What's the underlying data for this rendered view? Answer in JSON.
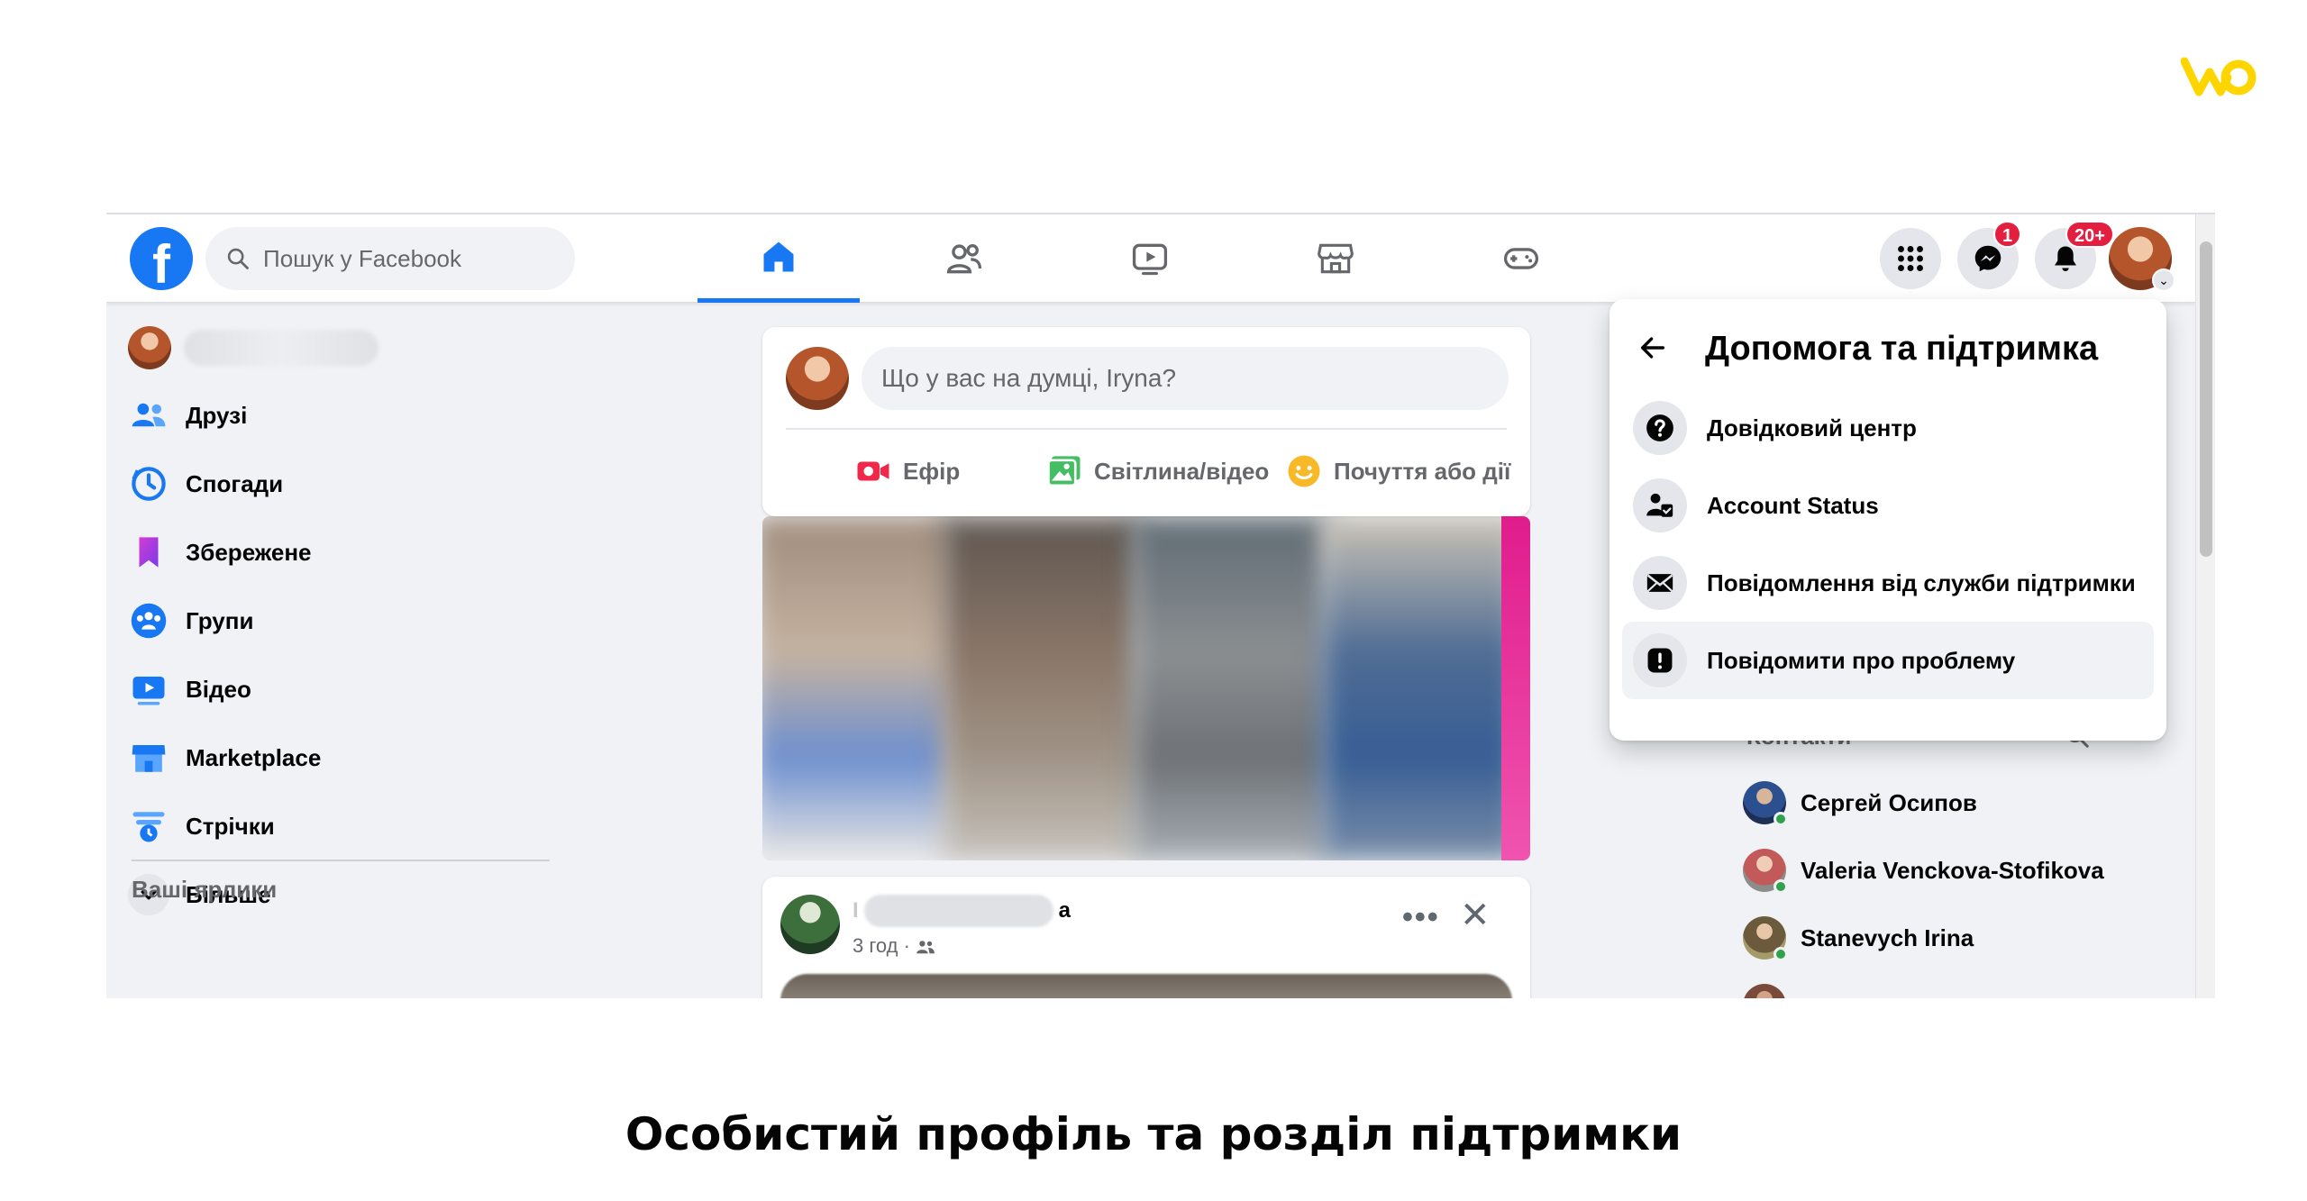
{
  "colors": {
    "accent": "#1877f2",
    "badge": "#e41e3f",
    "online": "#31a24c",
    "brand_logo": "#ffd500"
  },
  "topbar": {
    "logo_letter": "f",
    "search_placeholder": "Пошук у Facebook",
    "tabs": [
      {
        "icon": "home-icon",
        "active": true
      },
      {
        "icon": "friends-icon",
        "active": false
      },
      {
        "icon": "watch-icon",
        "active": false
      },
      {
        "icon": "marketplace-icon",
        "active": false
      },
      {
        "icon": "gaming-icon",
        "active": false
      }
    ],
    "menu_icon": "grid-icon",
    "messenger_badge": "1",
    "notifications_badge": "20+"
  },
  "sidebar": {
    "items": [
      {
        "label": "Друзі",
        "icon": "friends-icon"
      },
      {
        "label": "Спогади",
        "icon": "memories-icon"
      },
      {
        "label": "Збережене",
        "icon": "saved-icon"
      },
      {
        "label": "Групи",
        "icon": "groups-icon"
      },
      {
        "label": "Відео",
        "icon": "video-icon"
      },
      {
        "label": "Marketplace",
        "icon": "marketplace-icon"
      },
      {
        "label": "Стрічки",
        "icon": "feeds-icon"
      },
      {
        "label": "Більше",
        "icon": "chevron-down-icon"
      }
    ],
    "shortcuts_heading": "Ваші ярлики"
  },
  "composer": {
    "placeholder": "Що у вас на думці, Iryna?",
    "actions": [
      {
        "label": "Ефір",
        "icon": "live-video-icon"
      },
      {
        "label": "Світлина/відео",
        "icon": "photo-icon"
      },
      {
        "label": "Почуття або дії",
        "icon": "feeling-icon"
      }
    ]
  },
  "post": {
    "name_suffix": "а",
    "name_prefix": "І",
    "time": "3 год ·",
    "audience_icon": "friends-audience-icon"
  },
  "contacts": {
    "heading": "Контакти",
    "people": [
      {
        "name": "Сергей Осипов",
        "online": true
      },
      {
        "name": "Valeria Venckova-Stofikova",
        "online": true
      },
      {
        "name": "Stanevych Irina",
        "online": true
      }
    ]
  },
  "dropdown": {
    "title": "Допомога та підтримка",
    "items": [
      {
        "label": "Довідковий центр",
        "icon": "question-icon",
        "hover": false
      },
      {
        "label": "Account Status",
        "icon": "account-status-icon",
        "hover": false
      },
      {
        "label": "Повідомлення від служби підтримки",
        "icon": "envelope-icon",
        "hover": false
      },
      {
        "label": "Повідомити про проблему",
        "icon": "report-icon",
        "hover": true
      }
    ]
  },
  "caption": "Особистий профіль та розділ підтримки"
}
